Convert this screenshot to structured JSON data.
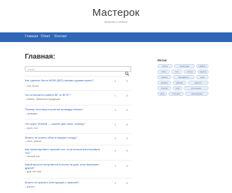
{
  "header": {
    "title": "Мастерок",
    "tagline": "вопросы и ответы"
  },
  "nav": [
    {
      "label": "Главная"
    },
    {
      "label": "Ответ"
    },
    {
      "label": "Контакт"
    }
  ],
  "main": {
    "title": "Главная:",
    "search_placeholder": "поиск",
    "questions": [
      {
        "title": "Как сделать бетон M250 (B20) своими руками нужно?",
        "meta": "– Full, бетон",
        "answers": "1",
        "views": "0"
      },
      {
        "title": "Что отличается кабель ВГ от ВГПГ?",
        "meta": "– кабель, кабельная продукция",
        "answers": "1",
        "views": "0"
      },
      {
        "title": "Почему лестница в розетке проводку питать?",
        "meta": "– проводка",
        "answers": "1",
        "views": "0"
      },
      {
        "title": "Что грунт тёплый — прочен для пола, почему?",
        "meta": "– грунт, пол",
        "answers": "1",
        "views": "0"
      },
      {
        "title": "Можно ли клеить обои в мокрую погоду?",
        "meta": "– обои, ремонт",
        "answers": "1",
        "views": "0"
      },
      {
        "title": "Как проектировать горячий пол, если нельзя использовать ток?",
        "meta": "– тёплый пол",
        "answers": "1",
        "views": "0"
      },
      {
        "title": "Какой высоты получается потолок на дом, если материал другой?",
        "meta": "– дом, потолок",
        "answers": "1",
        "views": "0"
      },
      {
        "title": "Можно ли красить конструкции с краской?",
        "meta": "– краска",
        "answers": "1",
        "views": "0"
      }
    ]
  },
  "sidebar": {
    "heading": "Метки",
    "tags": [
      "бетон",
      "электрика",
      "кабель",
      "обои",
      "пол",
      "стены",
      "крыша",
      "краска",
      "фундамент",
      "окна",
      "кровля",
      "дерево",
      "ремонт",
      "плитка",
      "гипс",
      "утепление",
      "дом",
      "потолок",
      "сантехника"
    ]
  }
}
